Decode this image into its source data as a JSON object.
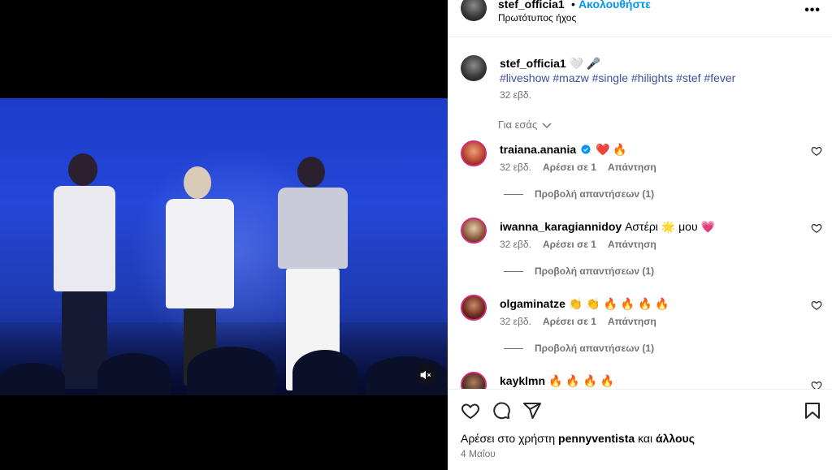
{
  "post": {
    "username": "stef_officia1",
    "dot": "•",
    "follow_label": "Ακολουθήστε",
    "audio": "Πρωτότυπος ήχος",
    "more_label": "•••"
  },
  "caption": {
    "username": "stef_officia1",
    "emoji": "🤍 🎤",
    "hashtags": [
      "#liveshow",
      "#mazw",
      "#single",
      "#hilights",
      "#stef",
      "#fever"
    ],
    "time": "32 εβδ."
  },
  "for_you_label": "Για εσάς",
  "comments": [
    {
      "username": "traiana.anania",
      "text": "❤️ 🔥",
      "verified": true,
      "time": "32 εβδ.",
      "likes": "Αρέσει σε 1",
      "reply": "Απάντηση",
      "replies": "Προβολή απαντήσεων (1)"
    },
    {
      "username": "iwanna_karagiannidoy",
      "text": "Αστέρι 🌟 μου 💗",
      "verified": false,
      "time": "32 εβδ.",
      "likes": "Αρέσει σε 1",
      "reply": "Απάντηση",
      "replies": "Προβολή απαντήσεων (1)"
    },
    {
      "username": "olgaminatze",
      "text": "👏 👏 🔥 🔥 🔥 🔥",
      "verified": false,
      "time": "32 εβδ.",
      "likes": "Αρέσει σε 1",
      "reply": "Απάντηση",
      "replies": "Προβολή απαντήσεων (1)"
    },
    {
      "username": "kayklmn",
      "text": "🔥 🔥 🔥 🔥",
      "verified": false
    }
  ],
  "footer": {
    "likes_prefix": "Αρέσει στο χρήστη",
    "likes_user": "pennyventista",
    "likes_and": "και",
    "likes_others": "άλλους",
    "date": "4 Μαΐου"
  },
  "colors": {
    "accent": "#0095f6",
    "hashtag": "#3c4f9e",
    "muted": "#737373",
    "stage_blue": "#2447d8"
  }
}
